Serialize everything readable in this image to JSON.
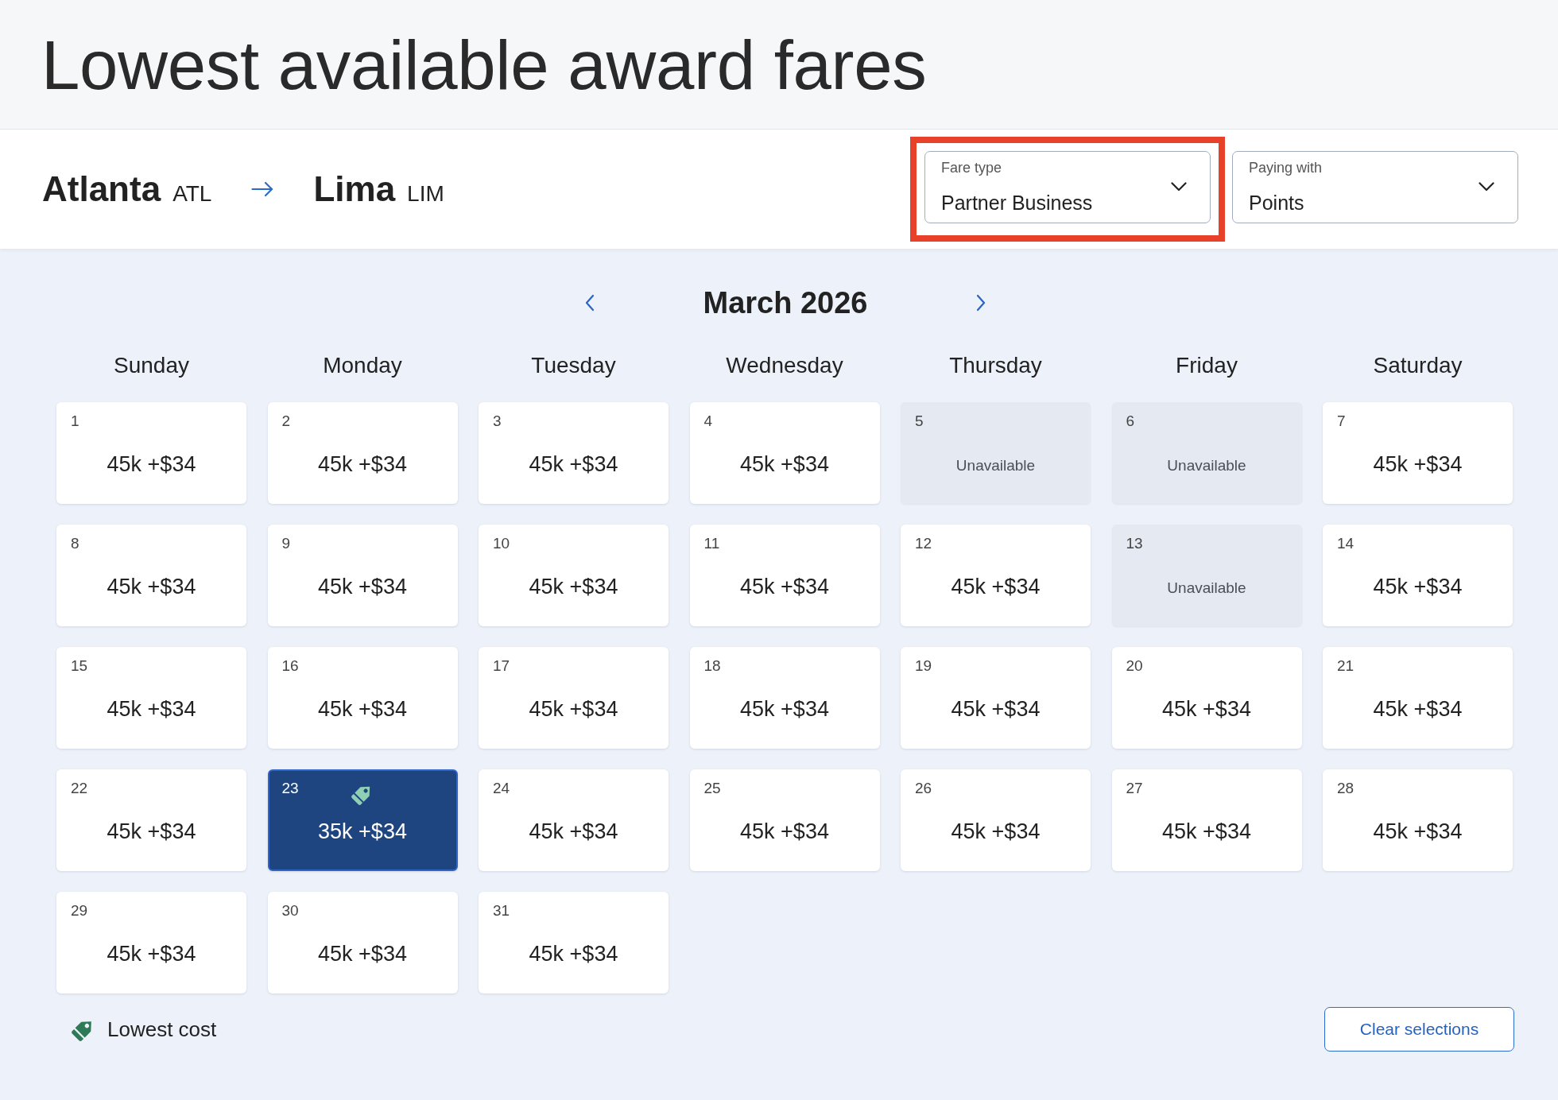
{
  "page_title": "Lowest available award fares",
  "route": {
    "origin": {
      "city": "Atlanta",
      "code": "ATL"
    },
    "destination": {
      "city": "Lima",
      "code": "LIM"
    }
  },
  "selectors": [
    {
      "label": "Fare type",
      "value": "Partner Business",
      "highlighted": true
    },
    {
      "label": "Paying with",
      "value": "Points",
      "highlighted": false
    }
  ],
  "calendar": {
    "month": "March 2026",
    "weekdays": [
      "Sunday",
      "Monday",
      "Tuesday",
      "Wednesday",
      "Thursday",
      "Friday",
      "Saturday"
    ],
    "days": [
      {
        "day": "1",
        "kind": "fare",
        "fare": "45k +$34",
        "selected": false,
        "lowest": false
      },
      {
        "day": "2",
        "kind": "fare",
        "fare": "45k +$34",
        "selected": false,
        "lowest": false
      },
      {
        "day": "3",
        "kind": "fare",
        "fare": "45k +$34",
        "selected": false,
        "lowest": false
      },
      {
        "day": "4",
        "kind": "fare",
        "fare": "45k +$34",
        "selected": false,
        "lowest": false
      },
      {
        "day": "5",
        "kind": "unavailable",
        "status": "Unavailable",
        "selected": false,
        "lowest": false
      },
      {
        "day": "6",
        "kind": "unavailable",
        "status": "Unavailable",
        "selected": false,
        "lowest": false
      },
      {
        "day": "7",
        "kind": "fare",
        "fare": "45k +$34",
        "selected": false,
        "lowest": false
      },
      {
        "day": "8",
        "kind": "fare",
        "fare": "45k +$34",
        "selected": false,
        "lowest": false
      },
      {
        "day": "9",
        "kind": "fare",
        "fare": "45k +$34",
        "selected": false,
        "lowest": false
      },
      {
        "day": "10",
        "kind": "fare",
        "fare": "45k +$34",
        "selected": false,
        "lowest": false
      },
      {
        "day": "11",
        "kind": "fare",
        "fare": "45k +$34",
        "selected": false,
        "lowest": false
      },
      {
        "day": "12",
        "kind": "fare",
        "fare": "45k +$34",
        "selected": false,
        "lowest": false
      },
      {
        "day": "13",
        "kind": "unavailable",
        "status": "Unavailable",
        "selected": false,
        "lowest": false
      },
      {
        "day": "14",
        "kind": "fare",
        "fare": "45k +$34",
        "selected": false,
        "lowest": false
      },
      {
        "day": "15",
        "kind": "fare",
        "fare": "45k +$34",
        "selected": false,
        "lowest": false
      },
      {
        "day": "16",
        "kind": "fare",
        "fare": "45k +$34",
        "selected": false,
        "lowest": false
      },
      {
        "day": "17",
        "kind": "fare",
        "fare": "45k +$34",
        "selected": false,
        "lowest": false
      },
      {
        "day": "18",
        "kind": "fare",
        "fare": "45k +$34",
        "selected": false,
        "lowest": false
      },
      {
        "day": "19",
        "kind": "fare",
        "fare": "45k +$34",
        "selected": false,
        "lowest": false
      },
      {
        "day": "20",
        "kind": "fare",
        "fare": "45k +$34",
        "selected": false,
        "lowest": false
      },
      {
        "day": "21",
        "kind": "fare",
        "fare": "45k +$34",
        "selected": false,
        "lowest": false
      },
      {
        "day": "22",
        "kind": "fare",
        "fare": "45k +$34",
        "selected": false,
        "lowest": false
      },
      {
        "day": "23",
        "kind": "fare",
        "fare": "35k +$34",
        "selected": true,
        "lowest": true
      },
      {
        "day": "24",
        "kind": "fare",
        "fare": "45k +$34",
        "selected": false,
        "lowest": false
      },
      {
        "day": "25",
        "kind": "fare",
        "fare": "45k +$34",
        "selected": false,
        "lowest": false
      },
      {
        "day": "26",
        "kind": "fare",
        "fare": "45k +$34",
        "selected": false,
        "lowest": false
      },
      {
        "day": "27",
        "kind": "fare",
        "fare": "45k +$34",
        "selected": false,
        "lowest": false
      },
      {
        "day": "28",
        "kind": "fare",
        "fare": "45k +$34",
        "selected": false,
        "lowest": false
      },
      {
        "day": "29",
        "kind": "fare",
        "fare": "45k +$34",
        "selected": false,
        "lowest": false
      },
      {
        "day": "30",
        "kind": "fare",
        "fare": "45k +$34",
        "selected": false,
        "lowest": false
      },
      {
        "day": "31",
        "kind": "fare",
        "fare": "45k +$34",
        "selected": false,
        "lowest": false
      }
    ]
  },
  "legend": {
    "label": "Lowest cost"
  },
  "clear_button": "Clear selections"
}
